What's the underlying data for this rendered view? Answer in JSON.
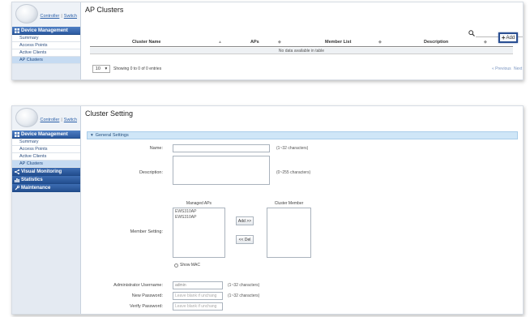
{
  "sidebar": {
    "controller_link": "Controller",
    "separator": "|",
    "switch_link": "Switch",
    "device_management": "Device Management",
    "items": [
      "Summary",
      "Access Points",
      "Active Clients",
      "AP Clusters"
    ],
    "visual_monitoring": "Visual Monitoring",
    "statistics": "Statistics",
    "maintenance": "Maintenance"
  },
  "clusters": {
    "title": "AP Clusters",
    "search_placeholder": "",
    "columns": [
      "Cluster Name",
      "APs",
      "Member List",
      "Description"
    ],
    "add_label": "Add",
    "empty_text": "No data available in table",
    "page_size": "10",
    "showing": "Showing 0 to 0 of 0 entries",
    "previous": "Previous",
    "next": "Next"
  },
  "setting": {
    "title": "Cluster Setting",
    "section": "General Settings",
    "name_label": "Name:",
    "name_hint": "(1~32 characters)",
    "description_label": "Description:",
    "description_hint": "(0~255 characters)",
    "member_label": "Member Setting:",
    "managed_aps_title": "Managed APs",
    "managed_aps": [
      "EWS310AP",
      "EWS310AP"
    ],
    "cluster_member_title": "Cluster Member",
    "add_btn": "Add >>",
    "del_btn": "<< Del",
    "show_mac": "Show MAC",
    "admin_user_label": "Administrator Username:",
    "admin_user_value": "admin",
    "admin_user_hint": "(1~32 characters)",
    "new_password_label": "New Password:",
    "new_password_placeholder": "Leave blank if unchang",
    "new_password_hint": "(1~32 characters)",
    "verify_password_label": "Verify Password:",
    "verify_password_placeholder": "Leave blank if unchang"
  }
}
